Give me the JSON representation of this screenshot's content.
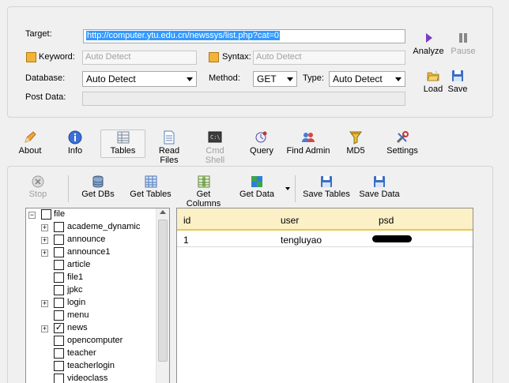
{
  "target": {
    "label": "Target:",
    "url": "http://computer.ytu.edu.cn/newssys/list.php?cat=0"
  },
  "keyword": {
    "label": "Keyword:",
    "placeholder": "Auto Detect"
  },
  "syntax": {
    "label": "Syntax:",
    "placeholder": "Auto Detect"
  },
  "database": {
    "label": "Database:",
    "value": "Auto Detect"
  },
  "method": {
    "label": "Method:",
    "value": "GET"
  },
  "type": {
    "label": "Type:",
    "value": "Auto Detect"
  },
  "post_data": {
    "label": "Post Data:"
  },
  "side_buttons": {
    "analyze": "Analyze",
    "pause": "Pause",
    "load": "Load",
    "save": "Save"
  },
  "toolbar": {
    "about": "About",
    "info": "Info",
    "tables": "Tables",
    "read_files": "Read Files",
    "cmd_shell": "Cmd Shell",
    "query": "Query",
    "find_admin": "Find Admin",
    "md5": "MD5",
    "settings": "Settings"
  },
  "table_toolbar": {
    "stop": "Stop",
    "get_dbs": "Get DBs",
    "get_tables": "Get Tables",
    "get_columns": "Get Columns",
    "get_data": "Get Data",
    "save_tables": "Save Tables",
    "save_data": "Save Data"
  },
  "tree": {
    "root": "file",
    "items": [
      {
        "name": "academe_dynamic",
        "expandable": true,
        "checked": false
      },
      {
        "name": "announce",
        "expandable": true,
        "checked": false
      },
      {
        "name": "announce1",
        "expandable": true,
        "checked": false
      },
      {
        "name": "article",
        "expandable": false,
        "checked": false
      },
      {
        "name": "file1",
        "expandable": false,
        "checked": false
      },
      {
        "name": "jpkc",
        "expandable": false,
        "checked": false
      },
      {
        "name": "login",
        "expandable": true,
        "checked": false
      },
      {
        "name": "menu",
        "expandable": false,
        "checked": false
      },
      {
        "name": "news",
        "expandable": true,
        "checked": true
      },
      {
        "name": "opencomputer",
        "expandable": false,
        "checked": false
      },
      {
        "name": "teacher",
        "expandable": false,
        "checked": false
      },
      {
        "name": "teacherlogin",
        "expandable": false,
        "checked": false
      },
      {
        "name": "videoclass",
        "expandable": false,
        "checked": false
      }
    ]
  },
  "grid": {
    "columns": [
      "id",
      "user",
      "psd"
    ],
    "rows": [
      {
        "id": "1",
        "user": "tengluyao"
      }
    ]
  },
  "colors": {
    "url_highlight": "#3399ff",
    "grid_header": "#fbf0c6",
    "grid_header_border": "#e9c74c"
  }
}
